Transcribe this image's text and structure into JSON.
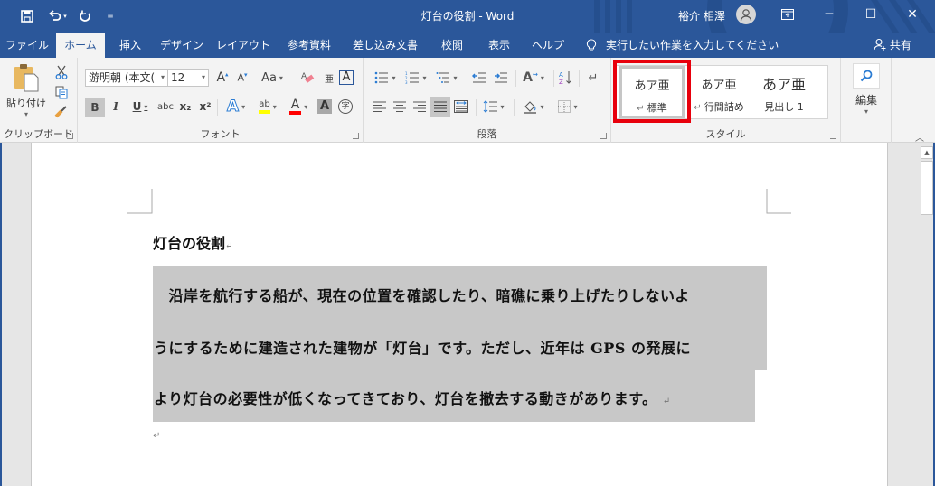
{
  "title_bar": {
    "doc_title": "灯台の役割 - Word",
    "user_name": "裕介 相澤",
    "quick_access": {
      "save_icon": "save-icon",
      "undo_icon": "undo-icon",
      "redo_icon": "redo-icon",
      "customize_icon": "customize-icon"
    },
    "window_controls": {
      "ribbon_options": "ribbon-display-options-icon",
      "minimize": "─",
      "maximize": "☐",
      "close": "✕"
    }
  },
  "tabs": [
    {
      "label": "ファイル"
    },
    {
      "label": "ホーム",
      "active": true
    },
    {
      "label": "挿入"
    },
    {
      "label": "デザイン"
    },
    {
      "label": "レイアウト"
    },
    {
      "label": "参考資料"
    },
    {
      "label": "差し込み文書"
    },
    {
      "label": "校閲"
    },
    {
      "label": "表示"
    },
    {
      "label": "ヘルプ"
    }
  ],
  "tell_me": "実行したい作業を入力してください",
  "share_label": "共有",
  "ribbon": {
    "clipboard": {
      "paste_label": "貼り付け",
      "group_label": "クリップボード"
    },
    "font": {
      "font_name": "游明朝 (本文(",
      "font_size": "12",
      "change_case": "Aa",
      "bold": "B",
      "italic": "I",
      "underline": "U",
      "strike": "abc",
      "subscript": "x₂",
      "superscript": "x²",
      "group_label": "フォント",
      "highlight_color": "#ffff00",
      "font_color": "#ff0000"
    },
    "paragraph": {
      "group_label": "段落"
    },
    "styles": {
      "items": [
        {
          "preview": "あア亜",
          "name": "標準",
          "selected": true
        },
        {
          "preview": "あア亜",
          "name": "行間詰め"
        },
        {
          "preview": "あア亜",
          "name": "見出し 1"
        }
      ],
      "group_label": "スタイル"
    },
    "editing": {
      "label": "編集"
    }
  },
  "document": {
    "heading": "灯台の役割",
    "lines": [
      "　沿岸を航行する船が、現在の位置を確認したり、暗礁に乗り上げたりしないよ",
      "うにするために建造された建物が「灯台」です。ただし、近年は GPS の発展に",
      "より灯台の必要性が低くなってきており、灯台を撤去する動きがあります。"
    ],
    "paragraph_mark": "↵"
  },
  "colors": {
    "accent": "#2b579a",
    "selection": "#c8c8c8",
    "highlight_box": "#e8000c"
  }
}
